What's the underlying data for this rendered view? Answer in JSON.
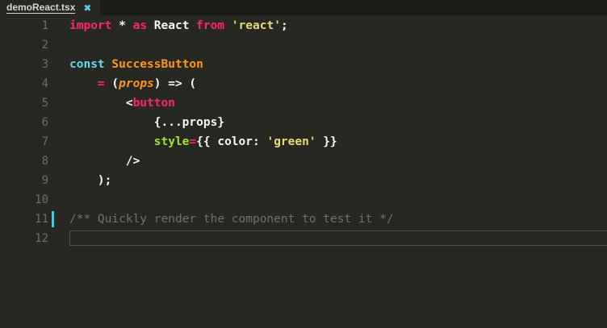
{
  "tab": {
    "title": "demoReact.tsx",
    "close_glyph": "✖"
  },
  "editor": {
    "line_numbers": [
      "1",
      "2",
      "3",
      "4",
      "5",
      "6",
      "7",
      "8",
      "9",
      "10",
      "11",
      "12"
    ],
    "active_line": 12,
    "modified_line_marker": 11,
    "code": {
      "l1": {
        "t1": "import",
        "t2": " * ",
        "t3": "as",
        "t4": " React ",
        "t5": "from",
        "t6": " ",
        "t7": "'react'",
        "t8": ";"
      },
      "l3": {
        "t1": "const",
        "t2": " ",
        "t3": "SuccessButton"
      },
      "l4": {
        "t1": "    ",
        "t2": "=",
        "t3": " (",
        "t4": "props",
        "t5": ") => ("
      },
      "l5": {
        "t1": "        <",
        "t2": "button"
      },
      "l6": {
        "t1": "            {...props}"
      },
      "l7": {
        "t1": "            ",
        "t2": "style",
        "t3": "=",
        "t4": "{{ color: ",
        "t5": "'green'",
        "t6": " }}"
      },
      "l8": {
        "t1": "        />"
      },
      "l9": {
        "t1": "    );"
      },
      "l11": {
        "t1": "/** Quickly render the component to test it */"
      }
    }
  },
  "colors": {
    "background": "#272822",
    "keyword_pink": "#f92672",
    "keyword_blue": "#66d9ef",
    "orange": "#fd971f",
    "string": "#e6db74",
    "attribute": "#a6e22e",
    "comment": "#75715e",
    "gutter_marker": "#4fc5dc"
  }
}
